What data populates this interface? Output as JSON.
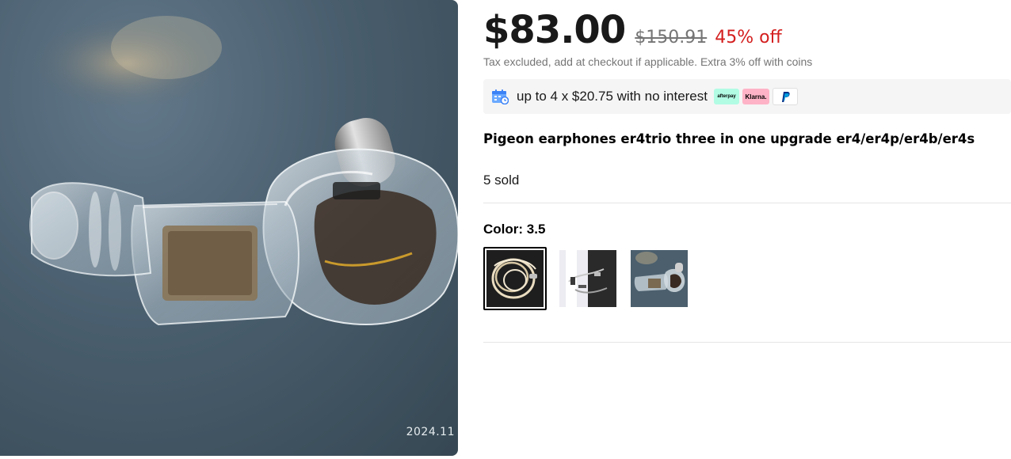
{
  "product_image": {
    "alt_icon": "earphone-photo",
    "stamp": "2024.11"
  },
  "price": {
    "current": "$83.00",
    "original": "$150.91",
    "discount": "45% off"
  },
  "tax_note": "Tax excluded, add at checkout if applicable. Extra 3% off with coins",
  "installment": {
    "text": "up to 4 x $20.75 with no interest",
    "icon": "calendar-payment-icon",
    "badges": [
      {
        "name": "afterpay",
        "label": "afterpay"
      },
      {
        "name": "klarna",
        "label": "Klarna."
      },
      {
        "name": "paypal",
        "label": "P"
      }
    ]
  },
  "product_title": "Pigeon earphones er4trio three in one upgrade er4/er4p/er4b/er4s",
  "sold": "5 sold",
  "color": {
    "label": "Color: ",
    "selected": "3.5",
    "options": [
      {
        "name": "cable-coil-swatch",
        "selected": true
      },
      {
        "name": "cable-box-swatch",
        "selected": false
      },
      {
        "name": "earphone-swatch",
        "selected": false
      }
    ]
  },
  "colors": {
    "price": "#191919",
    "discount": "#d41e1e",
    "muted": "#757575",
    "installment_bg": "#f5f5f5",
    "afterpay": "#b2fce4",
    "klarna": "#ffb3c7",
    "paypal_blue": "#003087"
  }
}
